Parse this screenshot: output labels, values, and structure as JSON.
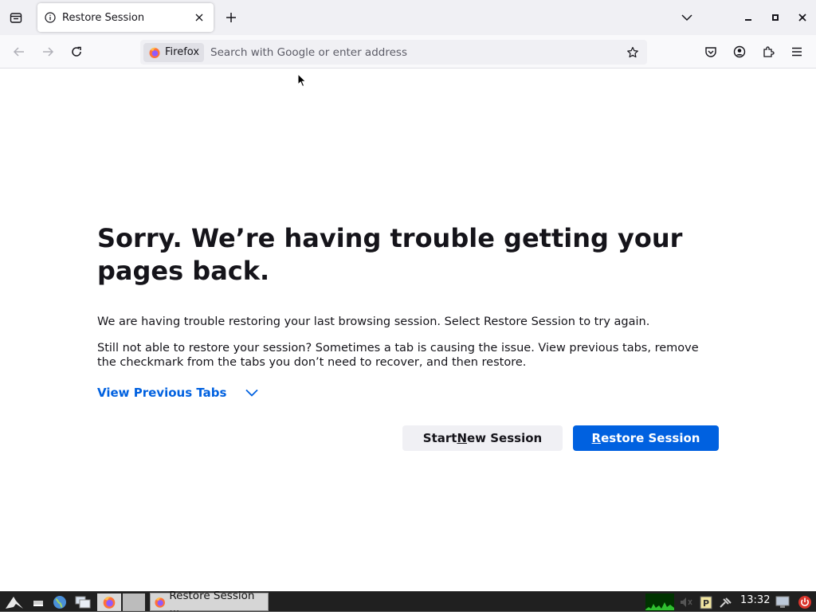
{
  "browser": {
    "tab": {
      "title": "Restore Session",
      "close_symbol": "×"
    },
    "newtab_symbol": "+",
    "window_controls": {
      "minimize": "–",
      "maximize": "▫",
      "close": "✕"
    },
    "identity_label": "Firefox",
    "url_placeholder": "Search with Google or enter address"
  },
  "page": {
    "headline": "Sorry. We’re having trouble getting your pages back.",
    "para1": "We are having trouble restoring your last browsing session. Select Restore Session to try again.",
    "para2": "Still not able to restore your session? Sometimes a tab is causing the issue. View previous tabs, remove the checkmark from the tabs you don’t need to recover, and then restore.",
    "view_tabs_label": "View Previous Tabs",
    "start_new": {
      "before": "Start ",
      "accel": "N",
      "after": "ew Session"
    },
    "restore": {
      "accel": "R",
      "after": "estore Session"
    }
  },
  "taskbar": {
    "task_label": "Restore Session ...",
    "clock": "13:32"
  },
  "colors": {
    "accent": "#0061e0",
    "text": "#15141a",
    "toolbar_bg": "#f9f9fb",
    "tabstrip_bg": "#f0f0f4",
    "taskbar_bg": "#202020"
  }
}
